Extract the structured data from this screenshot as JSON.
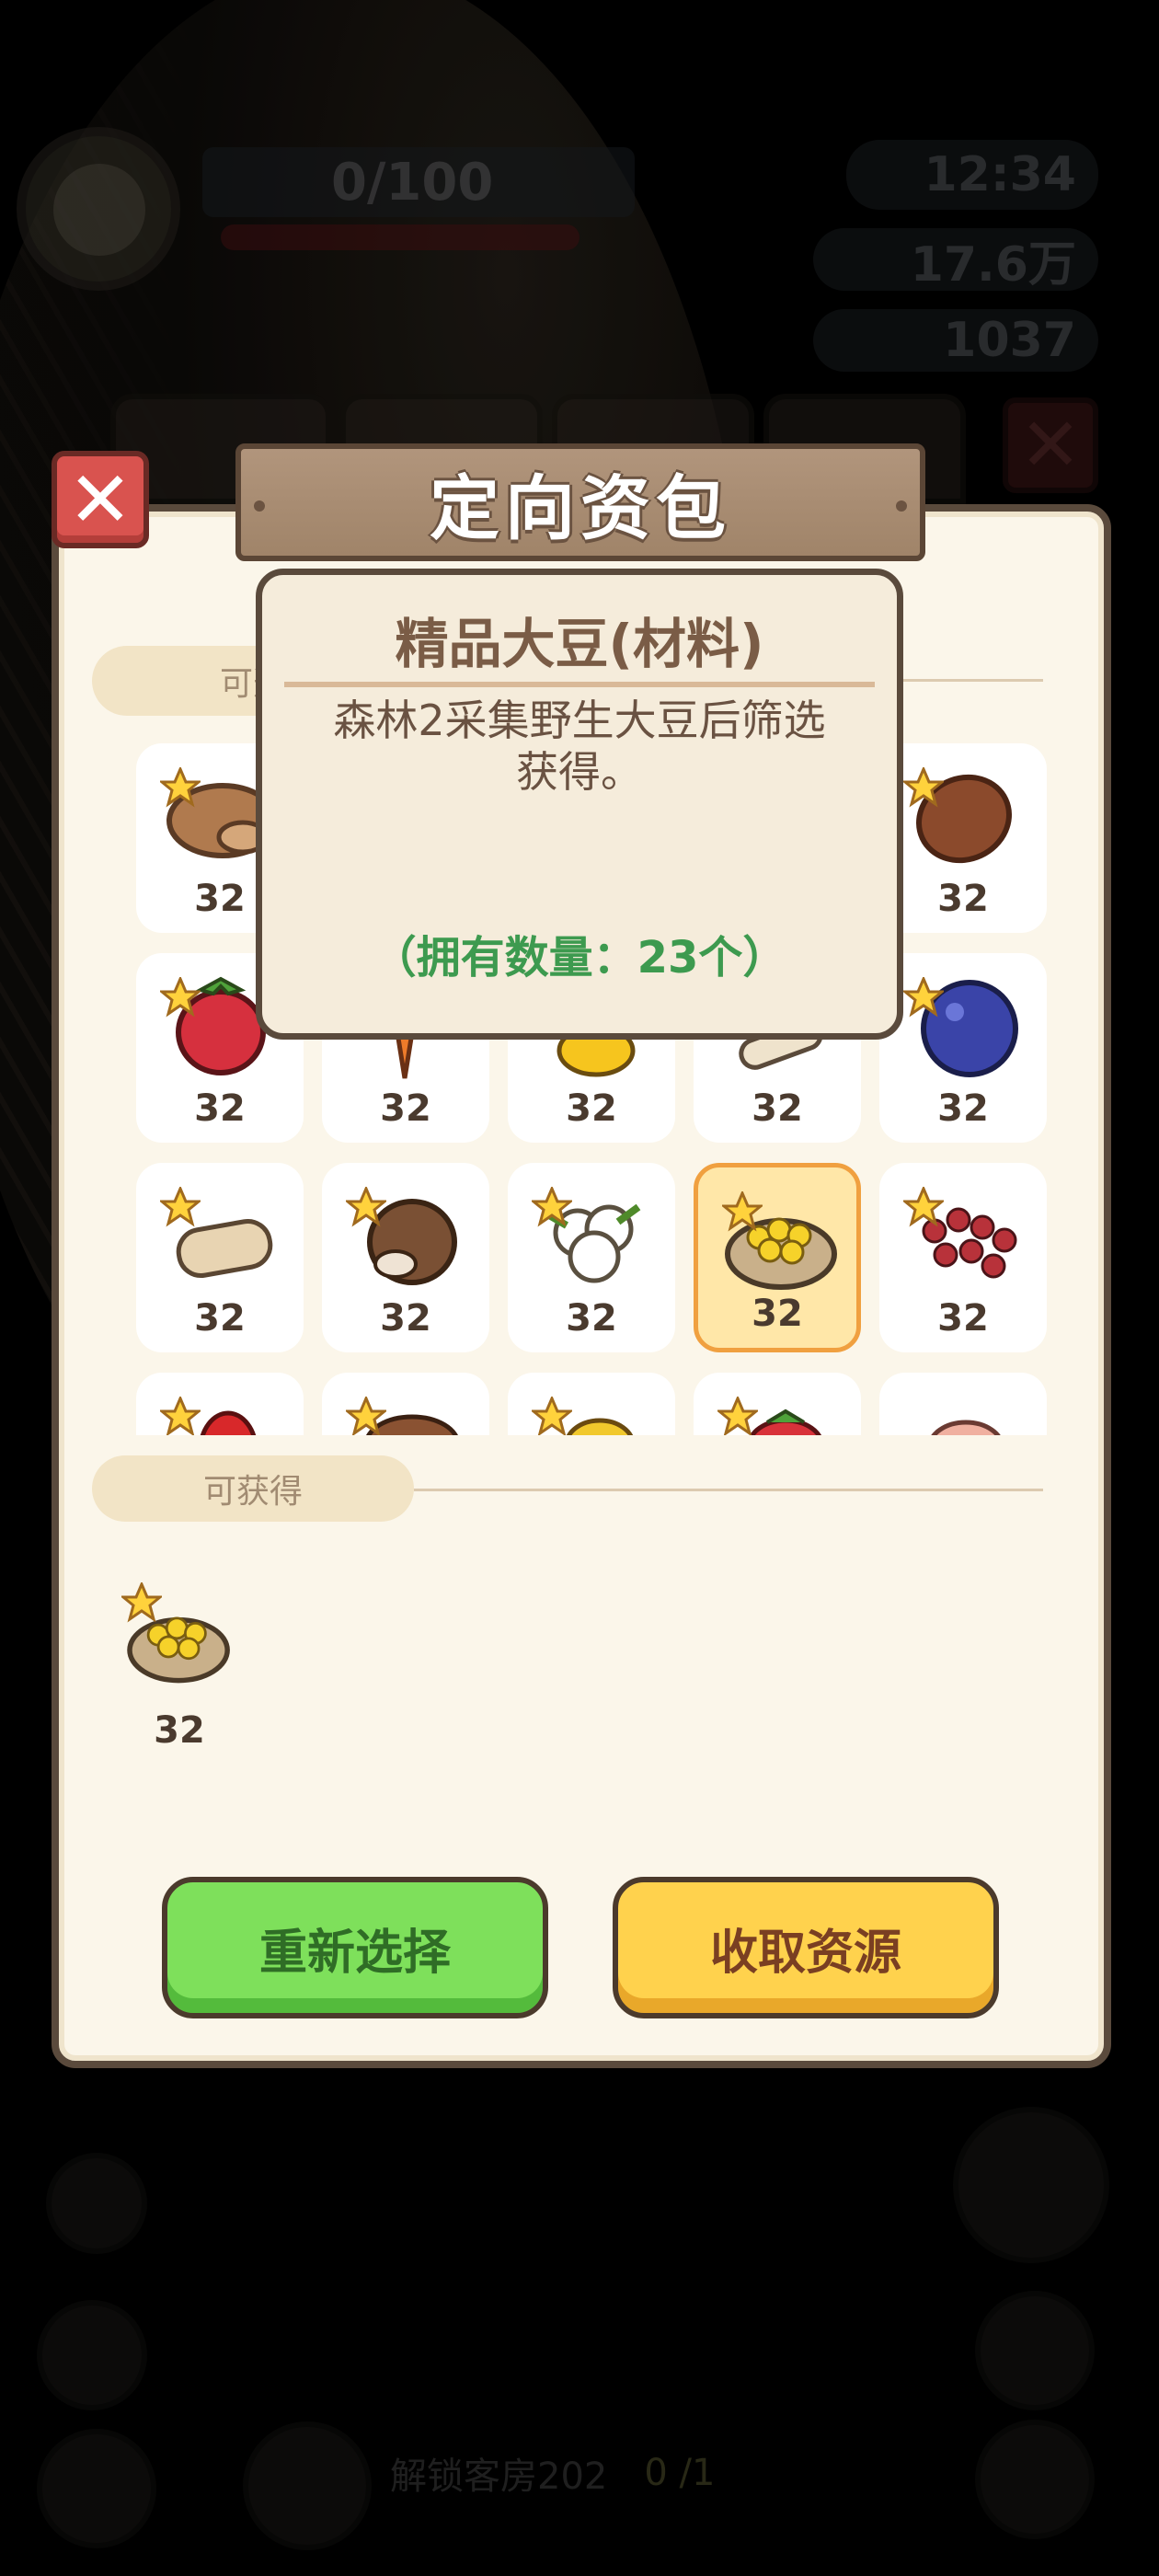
{
  "background": {
    "energy": "0/100",
    "timer": "12:34",
    "money": "17.6万",
    "gems": "1037",
    "room_label": "解锁客房202",
    "room_progress": "0 /1"
  },
  "dialog": {
    "title": "定向资包",
    "selectable_label": "可选",
    "obtainable_label": "可获得",
    "items": [
      {
        "name": "potato",
        "qty": "32"
      },
      {
        "name": "hidden-1",
        "qty": ""
      },
      {
        "name": "hidden-2",
        "qty": ""
      },
      {
        "name": "hidden-3",
        "qty": ""
      },
      {
        "name": "sweet-potato",
        "qty": "32"
      },
      {
        "name": "raspberry",
        "qty": "32"
      },
      {
        "name": "carrot",
        "qty": "32"
      },
      {
        "name": "lemon",
        "qty": "32"
      },
      {
        "name": "yam",
        "qty": "32"
      },
      {
        "name": "blueberry",
        "qty": "32"
      },
      {
        "name": "lotus-root",
        "qty": "32"
      },
      {
        "name": "taro",
        "qty": "32"
      },
      {
        "name": "cotton",
        "qty": "32"
      },
      {
        "name": "soybean",
        "qty": "32"
      },
      {
        "name": "red-berries",
        "qty": "32"
      }
    ],
    "obtain_item": {
      "name": "soybean",
      "qty": "32"
    },
    "reselect_button": "重新选择",
    "collect_button": "收取资源"
  },
  "tooltip": {
    "title": "精品大豆(材料)",
    "description": "森林2采集野生大豆后筛选获得。",
    "owned": "（拥有数量：23个）"
  },
  "colors": {
    "panel": "#fbf6ea",
    "border": "#5a4a3c",
    "green": "#7ee05b",
    "yellow": "#ffd24d",
    "owned_text": "#3d9a4f"
  }
}
